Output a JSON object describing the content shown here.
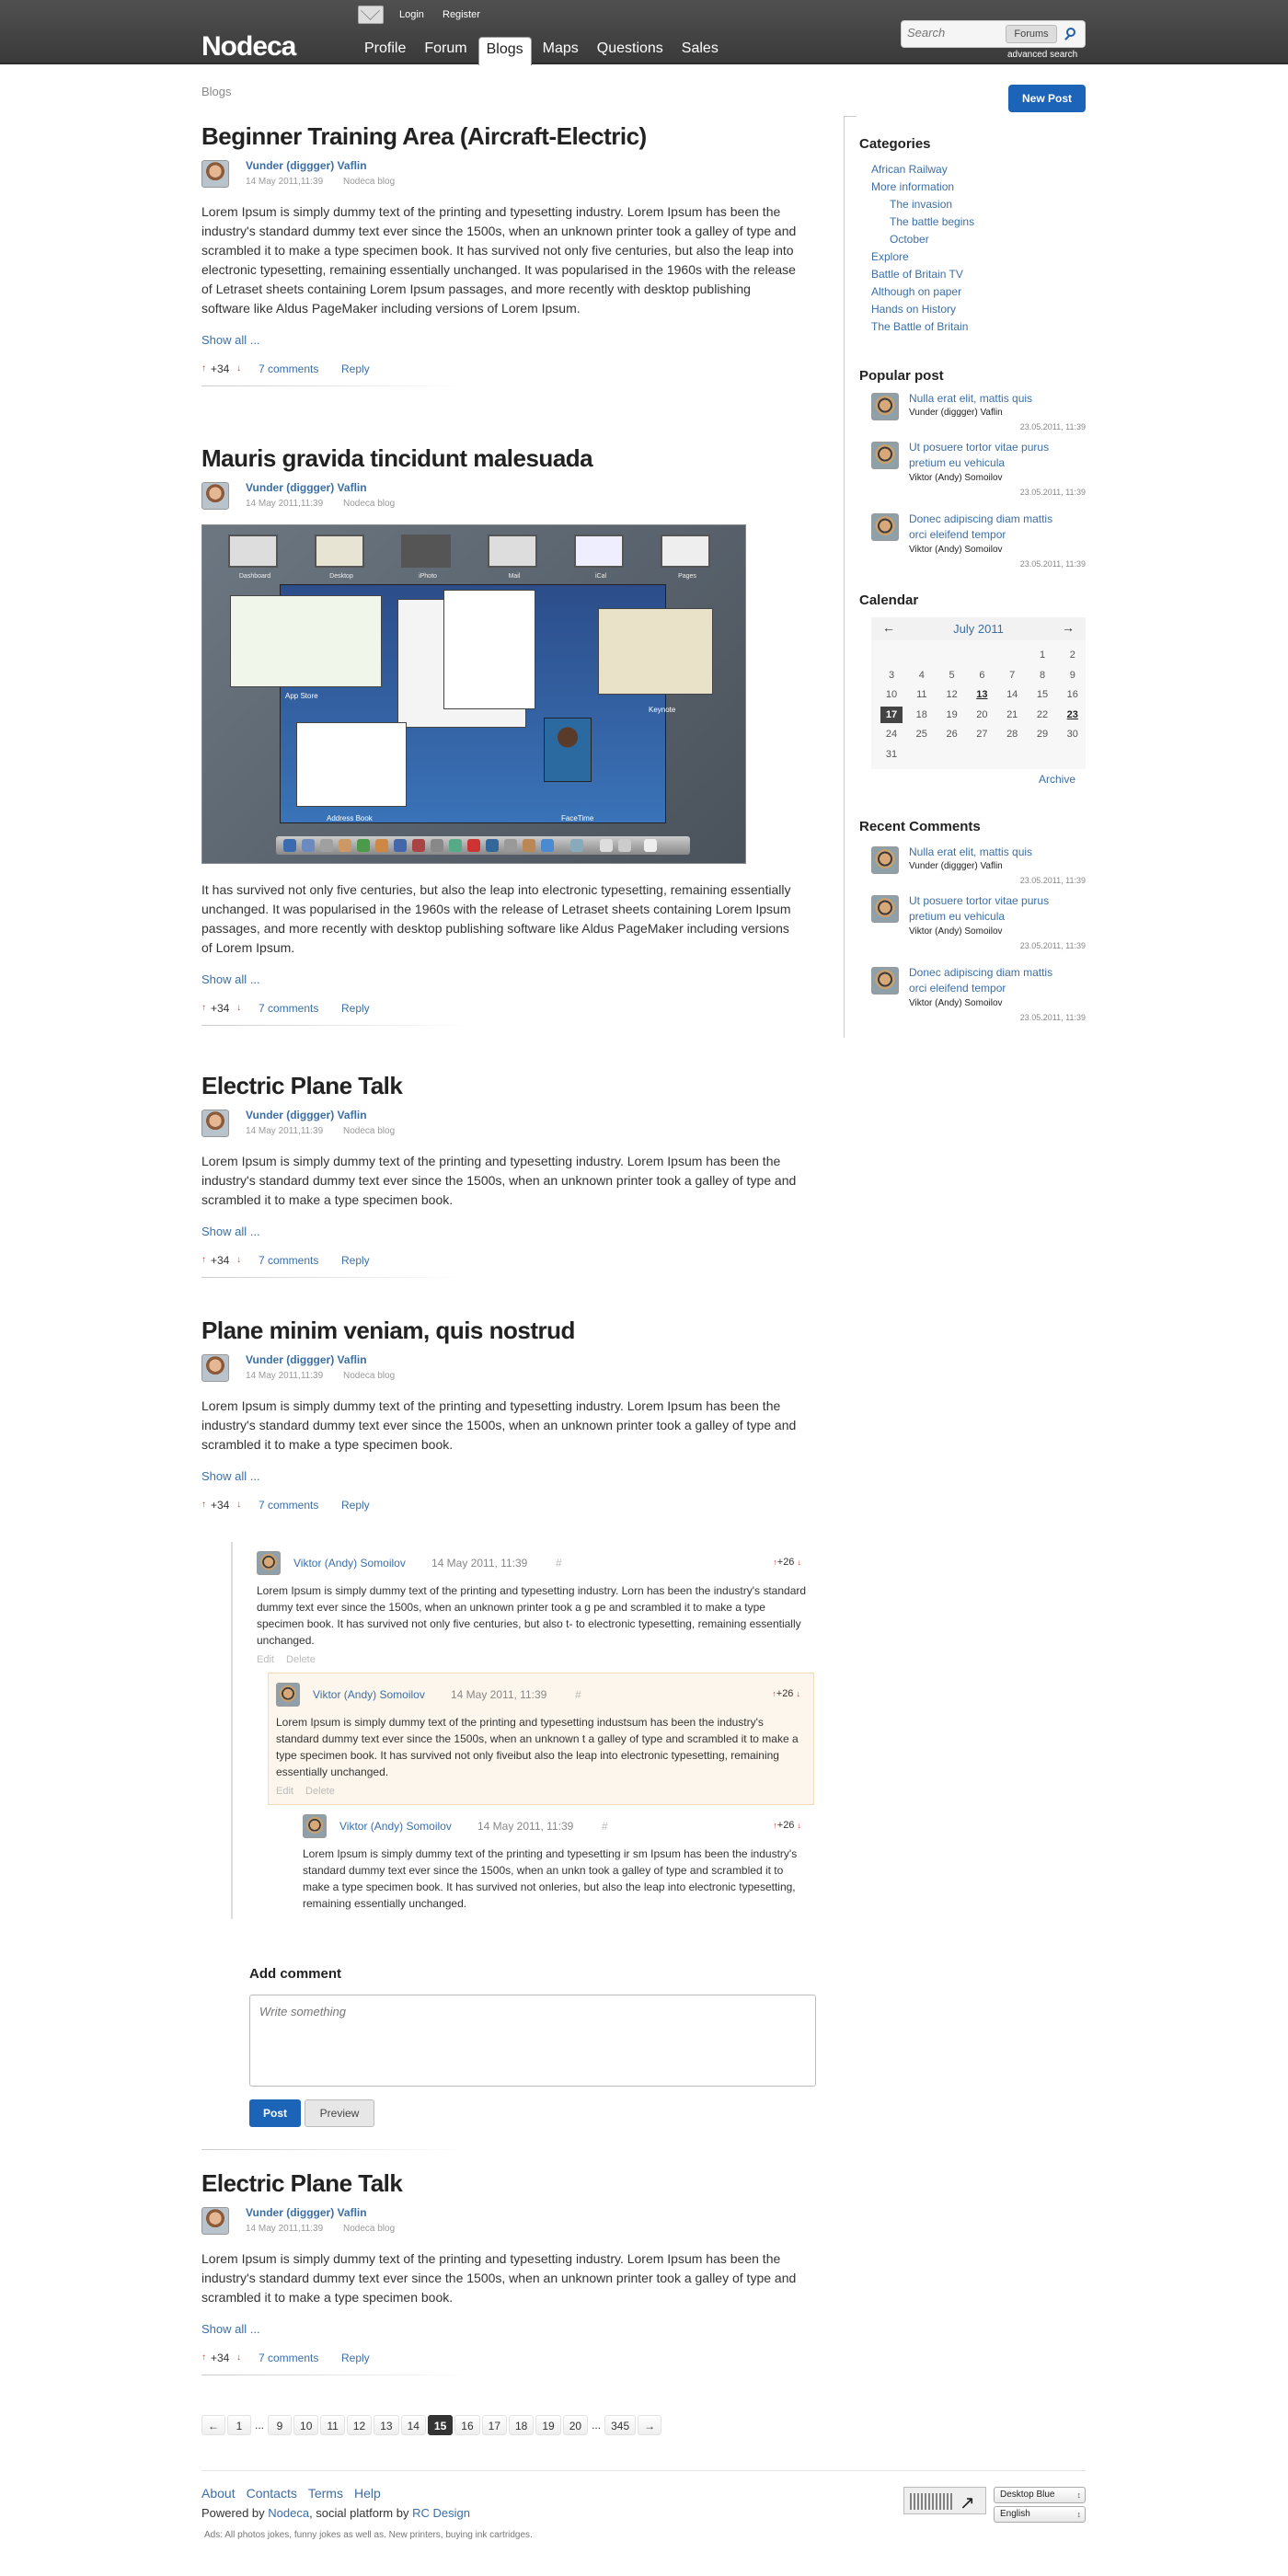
{
  "header": {
    "logo": "Nodeca",
    "login": "Login",
    "register": "Register",
    "nav": [
      "Profile",
      "Forum",
      "Blogs",
      "Maps",
      "Questions",
      "Sales"
    ],
    "active_nav": "Blogs",
    "search_placeholder": "Search",
    "search_scope": "Forums",
    "advanced_search": "advanced search"
  },
  "breadcrumb": "Blogs",
  "new_post": "New Post",
  "posts": [
    {
      "title": "Beginner Training Area (Aircraft-Electric)",
      "author": "Vunder (diggger) Vaflin",
      "date": "14 May 2011,11:39",
      "blog": "Nodeca blog",
      "body": "Lorem Ipsum is simply dummy text of the printing and typesetting industry. Lorem Ipsum has been the industry's standard dummy text ever since the 1500s, when an unknown printer took a galley of type and scrambled it to make a type specimen book. It has survived not only five centuries, but also the leap into electronic typesetting, remaining essentially unchanged. It was popularised in the 1960s with the release of Letraset sheets containing Lorem Ipsum passages, and more recently with desktop publishing software like Aldus PageMaker including versions of Lorem Ipsum.",
      "show_all": "Show all ...",
      "score": "+34",
      "comments": "7 comments",
      "reply": "Reply"
    },
    {
      "title": "Mauris gravida tincidunt malesuada",
      "author": "Vunder (diggger) Vaflin",
      "date": "14 May 2011,11:39",
      "blog": "Nodeca blog",
      "image_labels": [
        "Dashboard",
        "Desktop",
        "iPhoto",
        "Mail",
        "iCal",
        "Pages",
        "App Store",
        "Keynote",
        "Address Book",
        "FaceTime"
      ],
      "body": "It has survived not only five centuries, but also the leap into electronic typesetting, remaining essentially unchanged. It was popularised in the 1960s with the release of Letraset sheets containing Lorem Ipsum passages, and more recently with desktop publishing software like Aldus PageMaker including versions of Lorem Ipsum.",
      "show_all": "Show all ...",
      "score": "+34",
      "comments": "7 comments",
      "reply": "Reply"
    },
    {
      "title": "Electric Plane Talk",
      "author": "Vunder (diggger) Vaflin",
      "date": "14 May 2011,11:39",
      "blog": "Nodeca blog",
      "body": "Lorem Ipsum is simply dummy text of the printing and typesetting industry. Lorem Ipsum has been the industry's standard dummy text ever since the 1500s, when an unknown printer took a galley of type and scrambled it to make a type specimen book.",
      "show_all": "Show all ...",
      "score": "+34",
      "comments": "7 comments",
      "reply": "Reply"
    },
    {
      "title": "Plane minim veniam, quis nostrud",
      "author": "Vunder (diggger) Vaflin",
      "date": "14 May 2011,11:39",
      "blog": "Nodeca blog",
      "body": "Lorem Ipsum is simply dummy text of the printing and typesetting industry. Lorem Ipsum has been the industry's standard dummy text ever since the 1500s, when an unknown printer took a galley of type and scrambled it to make a type specimen book.",
      "show_all": "Show all ...",
      "score": "+34",
      "comments": "7 comments",
      "reply": "Reply"
    },
    {
      "title": "Electric Plane Talk",
      "author": "Vunder (diggger) Vaflin",
      "date": "14 May 2011,11:39",
      "blog": "Nodeca blog",
      "body": "Lorem Ipsum is simply dummy text of the printing and typesetting industry. Lorem Ipsum has been the industry's standard dummy text ever since the 1500s, when an unknown printer took a galley of type and scrambled it to make a type specimen book.",
      "show_all": "Show all ...",
      "score": "+34",
      "comments": "7 comments",
      "reply": "Reply"
    }
  ],
  "comments": [
    {
      "author": "Viktor (Andy) Somoilov",
      "date": "14 May 2011, 11:39",
      "hash": "#",
      "score": "+26",
      "body": "Lorem Ipsum is simply dummy text of the printing and typesetting industry. Lorn has been the industry's standard dummy text ever since the 1500s, when an unknown printer took a g pe and scrambled it to make a type specimen book. It has survived not only five centuries, but also t- to electronic typesetting, remaining essentially unchanged.",
      "edit": "Edit",
      "delete": "Delete"
    },
    {
      "author": "Viktor (Andy) Somoilov",
      "date": "14 May 2011, 11:39",
      "hash": "#",
      "score": "+26",
      "body": "Lorem Ipsum is simply dummy text of the printing and typesetting industsum has been the industry's standard dummy text ever since the 1500s, when an unknown t a galley of type and scrambled it to make a type specimen book. It has survived not only fiveibut also the leap into electronic typesetting, remaining essentially unchanged.",
      "edit": "Edit",
      "delete": "Delete"
    },
    {
      "author": "Viktor (Andy) Somoilov",
      "date": "14 May 2011, 11:39",
      "hash": "#",
      "score": "+26",
      "body": "Lorem Ipsum is simply dummy text of the printing and typesetting ir sm Ipsum has been the industry's standard dummy text ever since the 1500s, when an unkn took a galley of type and scrambled it to make a type specimen book. It has survived not onleries, but also the leap into electronic typesetting, remaining essentially unchanged."
    }
  ],
  "add_comment": {
    "title": "Add comment",
    "placeholder": "Write something",
    "post": "Post",
    "preview": "Preview"
  },
  "pager": [
    "←",
    "1",
    "...",
    "9",
    "10",
    "11",
    "12",
    "13",
    "14",
    "15",
    "16",
    "17",
    "18",
    "19",
    "20",
    "...",
    "345",
    "→"
  ],
  "pager_current": "15",
  "footer": {
    "links": [
      "About",
      "Contacts",
      "Terms",
      "Help"
    ],
    "powered_prefix": "Powered by ",
    "powered_nodeca": "Nodeca",
    "powered_mid": ", social platform by ",
    "powered_rc": "RC Design",
    "ads": "Ads: All photos jokes, funny jokes as well as. New printers, buying ink cartridges.",
    "theme": "Desktop Blue",
    "language": "English"
  },
  "sidebar": {
    "categories_title": "Categories",
    "categories": [
      {
        "label": "African Railway",
        "level": 0
      },
      {
        "label": "More information",
        "level": 0
      },
      {
        "label": "The invasion",
        "level": 1
      },
      {
        "label": "The battle begins",
        "level": 1
      },
      {
        "label": "October",
        "level": 1
      },
      {
        "label": "Explore",
        "level": 0
      },
      {
        "label": "Battle of Britain TV",
        "level": 0
      },
      {
        "label": "Although on paper",
        "level": 0
      },
      {
        "label": "Hands on History",
        "level": 0
      },
      {
        "label": "The Battle of Britain",
        "level": 0
      }
    ],
    "popular_title": "Popular post",
    "popular": [
      {
        "title": "Nulla erat elit, mattis quis",
        "author": "Vunder (diggger) Vaflin",
        "time": "23.05.2011, 11:39"
      },
      {
        "title": "Ut posuere tortor vitae purus pretium eu vehicula",
        "author": "Viktor (Andy) Somoilov",
        "time": "23.05.2011, 11:39"
      },
      {
        "title": "Donec adipiscing diam mattis orci eleifend tempor",
        "author": "Viktor (Andy) Somoilov",
        "time": "23.05.2011, 11:39"
      }
    ],
    "calendar_title": "Calendar",
    "calendar_month": "July 2011",
    "calendar_prev": "←",
    "calendar_next": "→",
    "calendar_weeks": [
      [
        "",
        "",
        "",
        "",
        "",
        "1",
        "2"
      ],
      [
        "3",
        "4",
        "5",
        "6",
        "7",
        "8",
        "9"
      ],
      [
        "10",
        "11",
        "12",
        "13",
        "14",
        "15",
        "16"
      ],
      [
        "17",
        "18",
        "19",
        "20",
        "21",
        "22",
        "23"
      ],
      [
        "24",
        "25",
        "26",
        "27",
        "28",
        "29",
        "30"
      ],
      [
        "31",
        "",
        "",
        "",
        "",
        "",
        ""
      ]
    ],
    "calendar_today": "17",
    "calendar_marked": [
      "13",
      "23"
    ],
    "archive": "Archive",
    "recent_title": "Recent Comments",
    "recent": [
      {
        "title": "Nulla erat elit, mattis quis",
        "author": "Vunder (diggger) Vaflin",
        "time": "23.05.2011, 11:39"
      },
      {
        "title": "Ut posuere tortor vitae purus pretium eu vehicula",
        "author": "Viktor (Andy) Somoilov",
        "time": "23.05.2011, 11:39"
      },
      {
        "title": "Donec adipiscing diam mattis orci eleifend tempor",
        "author": "Viktor (Andy) Somoilov",
        "time": "23.05.2011, 11:39"
      }
    ]
  }
}
